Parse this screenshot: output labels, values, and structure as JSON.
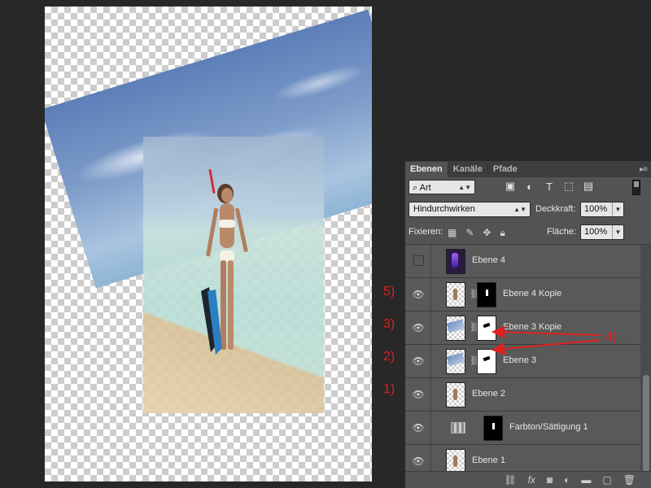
{
  "panel": {
    "tabs": [
      {
        "label": "Ebenen",
        "active": true
      },
      {
        "label": "Kanäle",
        "active": false
      },
      {
        "label": "Pfade",
        "active": false
      }
    ],
    "filter_value": "Art",
    "blend_mode": "Hindurchwirken",
    "opacity_label": "Deckkraft:",
    "opacity_value": "100%",
    "lock_label": "Fixieren:",
    "fill_label": "Fläche:",
    "fill_value": "100%"
  },
  "layers": [
    {
      "name": "Ebene 4",
      "visible": false,
      "thumb": "purple",
      "mask": null,
      "annotation": ""
    },
    {
      "name": "Ebene 4 Kopie",
      "visible": true,
      "thumb": "figure",
      "mask": "black",
      "annotation": "5)"
    },
    {
      "name": "Ebene 3 Kopie",
      "visible": true,
      "thumb": "sky",
      "mask": "white",
      "annotation": "3)"
    },
    {
      "name": "Ebene 3",
      "visible": true,
      "thumb": "sky",
      "mask": "white",
      "annotation": "2)"
    },
    {
      "name": "Ebene 2",
      "visible": true,
      "thumb": "figure",
      "mask": null,
      "annotation": "1)"
    },
    {
      "name": "Farbton/Sättigung 1",
      "visible": true,
      "thumb": "adjustment",
      "mask": "black",
      "annotation": ""
    },
    {
      "name": "Ebene 1",
      "visible": true,
      "thumb": "figure",
      "mask": null,
      "annotation": ""
    }
  ],
  "annotations": {
    "arrow_label": "4)"
  },
  "colors": {
    "annotation": "#e02020",
    "panel_bg": "#535353",
    "app_bg": "#282828"
  }
}
